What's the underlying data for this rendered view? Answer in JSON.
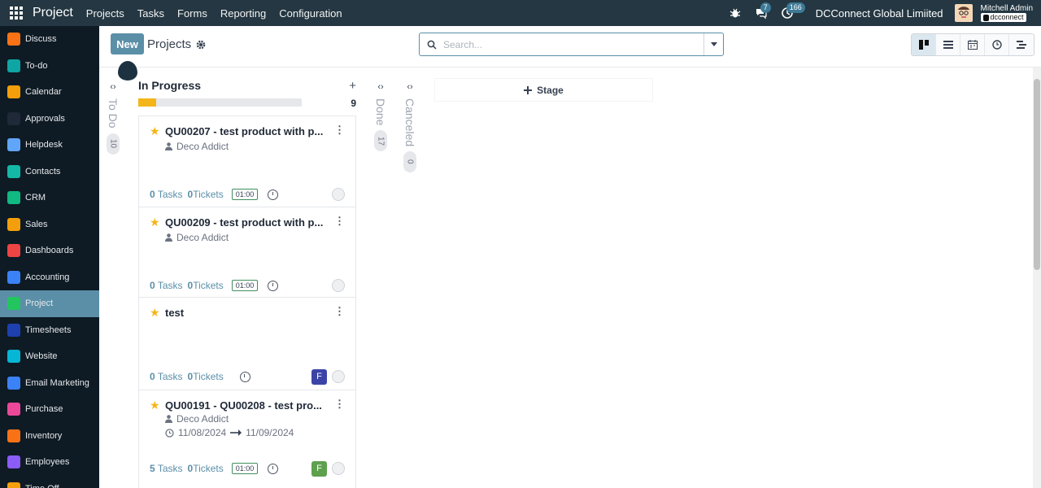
{
  "navbar": {
    "app_title": "Project",
    "menu": [
      "Projects",
      "Tasks",
      "Forms",
      "Reporting",
      "Configuration"
    ],
    "messages_count": "7",
    "activities_count": "166",
    "company": "DCConnect Global Limiited",
    "user_name": "Mitchell Admin",
    "database": "dcconnect"
  },
  "sidebar": {
    "items": [
      {
        "label": "Discuss",
        "icon": "discuss-icon",
        "color": "#f97316"
      },
      {
        "label": "To-do",
        "icon": "todo-icon",
        "color": "#0ea5a4"
      },
      {
        "label": "Calendar",
        "icon": "calendar-icon",
        "color": "#f59e0b"
      },
      {
        "label": "Approvals",
        "icon": "approvals-icon",
        "color": "#1f2937"
      },
      {
        "label": "Helpdesk",
        "icon": "helpdesk-icon",
        "color": "#60a5fa"
      },
      {
        "label": "Contacts",
        "icon": "contacts-icon",
        "color": "#14b8a6"
      },
      {
        "label": "CRM",
        "icon": "crm-icon",
        "color": "#10b981"
      },
      {
        "label": "Sales",
        "icon": "sales-icon",
        "color": "#f59e0b"
      },
      {
        "label": "Dashboards",
        "icon": "dashboards-icon",
        "color": "#ef4444"
      },
      {
        "label": "Accounting",
        "icon": "accounting-icon",
        "color": "#3b82f6"
      },
      {
        "label": "Project",
        "icon": "project-icon",
        "color": "#22c55e"
      },
      {
        "label": "Timesheets",
        "icon": "timesheets-icon",
        "color": "#1e40af"
      },
      {
        "label": "Website",
        "icon": "website-icon",
        "color": "#06b6d4"
      },
      {
        "label": "Email Marketing",
        "icon": "email-marketing-icon",
        "color": "#3b82f6"
      },
      {
        "label": "Purchase",
        "icon": "purchase-icon",
        "color": "#ec4899"
      },
      {
        "label": "Inventory",
        "icon": "inventory-icon",
        "color": "#f97316"
      },
      {
        "label": "Employees",
        "icon": "employees-icon",
        "color": "#8b5cf6"
      },
      {
        "label": "Time Off",
        "icon": "time-off-icon",
        "color": "#f59e0b"
      }
    ],
    "active_index": 10
  },
  "control": {
    "new_label": "New",
    "breadcrumb": "Projects",
    "search_placeholder": "Search..."
  },
  "kanban": {
    "folded_stages": [
      {
        "label": "To Do",
        "count": "10"
      },
      {
        "label": "Done",
        "count": "17"
      },
      {
        "label": "Canceled",
        "count": "0"
      }
    ],
    "column": {
      "title": "In Progress",
      "count": "9",
      "progress": 0.11
    },
    "cards": [
      {
        "title": "QU00207 - test product with p...",
        "customer": "Deco Addict",
        "dates": null,
        "tasks": "0",
        "tasks_label": "Tasks",
        "tickets": "0",
        "tickets_label": "Tickets",
        "timer": "01:00",
        "user_initial": null,
        "user_color": null
      },
      {
        "title": "QU00209 - test product with p...",
        "customer": "Deco Addict",
        "dates": null,
        "tasks": "0",
        "tasks_label": "Tasks",
        "tickets": "0",
        "tickets_label": "Tickets",
        "timer": "01:00",
        "user_initial": null,
        "user_color": null
      },
      {
        "title": "test",
        "customer": null,
        "dates": null,
        "tasks": "0",
        "tasks_label": "Tasks",
        "tickets": "0",
        "tickets_label": "Tickets",
        "timer": null,
        "user_initial": "F",
        "user_color": "#3b44a6"
      },
      {
        "title": "QU00191 - QU00208 - test pro...",
        "customer": "Deco Addict",
        "dates": {
          "start": "11/08/2024",
          "end": "11/09/2024"
        },
        "tasks": "5",
        "tasks_label": "Tasks",
        "tickets": "0",
        "tickets_label": "Tickets",
        "timer": "01:00",
        "user_initial": "F",
        "user_color": "#5fa04e"
      }
    ],
    "add_stage_label": "Stage"
  }
}
